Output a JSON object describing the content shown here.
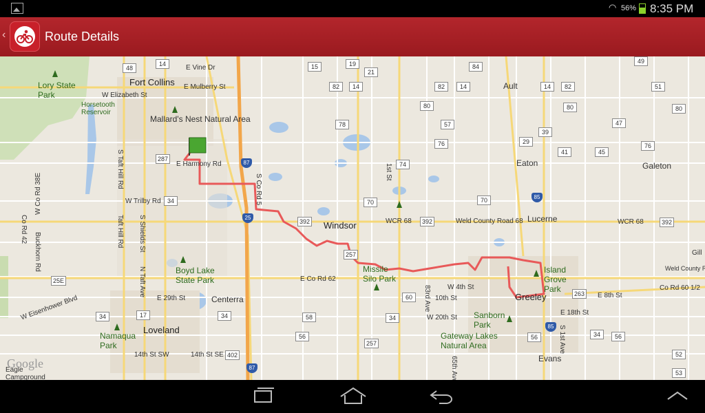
{
  "status": {
    "battery": "56%",
    "time": "8:35 PM"
  },
  "header": {
    "title": "Route Details"
  },
  "map": {
    "attribution": "Google",
    "places": {
      "fort_collins": "Fort Collins",
      "mallards": "Mallard's Nest Natural Area",
      "lory": "Lory State Park",
      "horsetooth": "Horsetooth Reservoir",
      "windsor": "Windsor",
      "loveland": "Loveland",
      "greeley": "Greeley",
      "eaton": "Eaton",
      "galeton": "Galeton",
      "ault": "Ault",
      "lucerne": "Lucerne",
      "evans": "Evans",
      "centerra": "Centerra",
      "boyd": "Boyd Lake State Park",
      "missile": "Missile Silo Park",
      "sanborn": "Sanborn Park",
      "gateway": "Gateway Lakes Natural Area",
      "island_grove": "Island Grove Park",
      "namaqua": "Namaqua Park",
      "eagle": "Eagle Campground"
    },
    "roads": {
      "vine": "E Vine Dr",
      "mulberry": "E Mulberry St",
      "elizabeth": "W Elizabeth St",
      "harmony": "E Harmony Rd",
      "trilby": "W Trilby Rd",
      "wcr68": "WCR 68",
      "weld68": "Weld County Road 68",
      "ecord62": "E Co Rd 62",
      "w4th": "W 4th St",
      "10th": "10th St",
      "w20th": "W 20th St",
      "e29th": "E 29th St",
      "e14th": "14th St SE",
      "sw14th": "14th St SW",
      "e8th": "E 8th St",
      "e18th": "E 18th St",
      "weldcounty": "Weld County Rd",
      "cord60": "Co Rd 60 1/2",
      "wcord38e": "W Co Rd 38E",
      "cord42": "Co Rd 42",
      "buckhorn": "Buckhorn Rd",
      "eisenhower": "W Eisenhower Blvd",
      "staft": "S Taft Hill Rd",
      "taft": "Taft Hill Rd",
      "sshields": "S Shields St",
      "ntaft": "N Taft Ave",
      "scord5": "S Co Rd 5",
      "st1": "1st St",
      "83rd": "83rd Ave",
      "65th": "65th Ave",
      "s1st": "S 1st Ave",
      "gill": "Gill",
      "wcr68b": "WCR 68",
      "weldcou": "Weld Cou"
    },
    "shields": [
      "48",
      "14",
      "15",
      "19",
      "84",
      "49",
      "14",
      "21",
      "82",
      "14",
      "82",
      "14",
      "82",
      "51",
      "80",
      "80",
      "80",
      "78",
      "76",
      "39",
      "47",
      "57",
      "29",
      "41",
      "45",
      "76",
      "287",
      "87",
      "74",
      "34",
      "25",
      "392",
      "70",
      "70",
      "85",
      "392",
      "392",
      "257",
      "60",
      "34",
      "17",
      "34",
      "58",
      "34",
      "56",
      "257",
      "56",
      "402",
      "87",
      "263",
      "34",
      "85",
      "56",
      "52",
      "53",
      "25E"
    ]
  }
}
